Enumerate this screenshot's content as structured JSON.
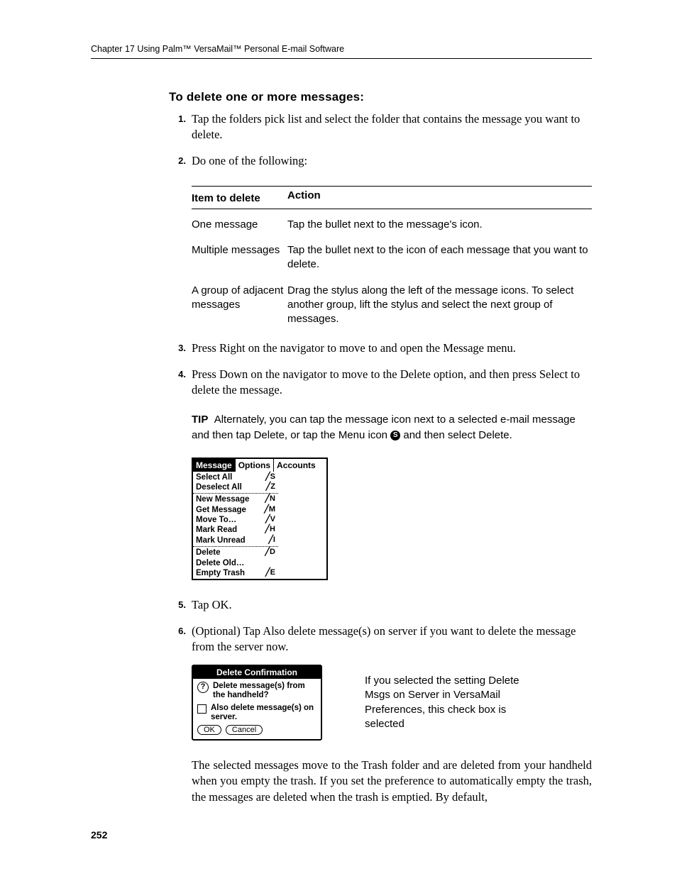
{
  "header": {
    "text": "Chapter 17   Using Palm™ VersaMail™ Personal E-mail Software"
  },
  "heading": "To delete one or more messages:",
  "steps": {
    "s1": {
      "num": "1.",
      "text": "Tap the folders pick list and select the folder that contains the message you want to delete."
    },
    "s2": {
      "num": "2.",
      "text": "Do one of the following:"
    },
    "s3": {
      "num": "3.",
      "text": "Press Right on the navigator to move to and open the Message menu."
    },
    "s4": {
      "num": "4.",
      "text": "Press Down on the navigator to move to the Delete option, and then press Select to delete the message."
    },
    "s5": {
      "num": "5.",
      "text": "Tap OK."
    },
    "s6": {
      "num": "6.",
      "text": "(Optional) Tap Also delete message(s) on server if you want to delete the message from the server now."
    }
  },
  "table": {
    "head_item": "Item to delete",
    "head_action": "Action",
    "rows": [
      {
        "item": "One message",
        "action": "Tap the bullet next to the message's icon."
      },
      {
        "item": "Multiple messages",
        "action": "Tap the bullet next to the icon of each message that you want to delete."
      },
      {
        "item": "A group of adjacent messages",
        "action": "Drag the stylus along the left of the message icons. To select another group, lift the stylus and select the next group of messages."
      }
    ]
  },
  "tip": {
    "label": "TIP",
    "text_before": "Alternately, you can tap the message icon next to a selected e-mail message and then tap Delete, or tap the Menu icon ",
    "text_after": " and then select Delete."
  },
  "palm_menu": {
    "tabs": [
      "Message",
      "Options",
      "Accounts"
    ],
    "sections": [
      [
        {
          "label": "Select All",
          "shortcut": "╱S"
        },
        {
          "label": "Deselect All",
          "shortcut": "╱Z"
        }
      ],
      [
        {
          "label": "New Message",
          "shortcut": "╱N"
        },
        {
          "label": "Get Message",
          "shortcut": "╱M"
        },
        {
          "label": "Move To…",
          "shortcut": "╱V"
        },
        {
          "label": "Mark Read",
          "shortcut": "╱H"
        },
        {
          "label": "Mark Unread",
          "shortcut": "╱I"
        }
      ],
      [
        {
          "label": "Delete",
          "shortcut": "╱D"
        },
        {
          "label": "Delete Old…",
          "shortcut": ""
        },
        {
          "label": "Empty Trash",
          "shortcut": "╱E"
        }
      ]
    ]
  },
  "dialog": {
    "title": "Delete Confirmation",
    "line1": "Delete message(s) from the handheld?",
    "line2": "Also delete message(s) on server.",
    "ok": "OK",
    "cancel": "Cancel"
  },
  "callout": "If you selected the setting Delete Msgs on Server in VersaMail Preferences, this check box is selected",
  "closing_para": "The selected messages move to the Trash folder and are deleted from your handheld when you empty the trash. If you set the preference to automatically empty the trash, the messages are deleted when the trash is emptied. By default,",
  "page_number": "252"
}
